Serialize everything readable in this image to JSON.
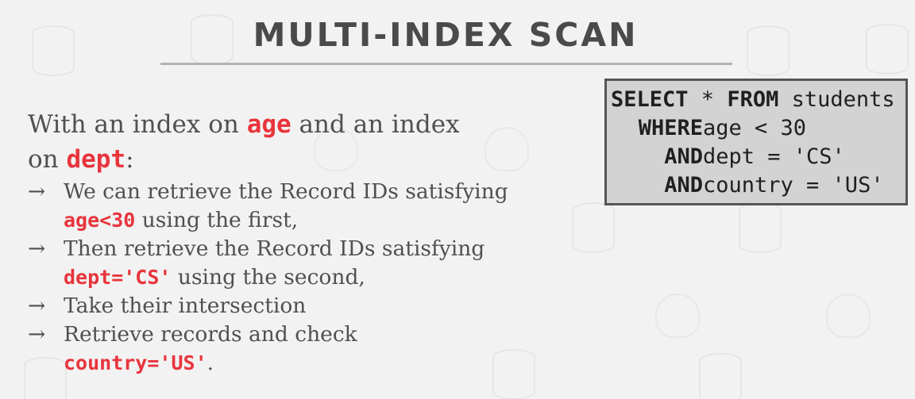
{
  "slide": {
    "title": "MULTI-INDEX SCAN"
  },
  "intro": {
    "text_1": "With an index on ",
    "code_1": "age",
    "text_2": " and an index",
    "text_3": "on ",
    "code_2": "dept",
    "text_4": ":"
  },
  "bullets": [
    {
      "arrow": "→",
      "line_1": "We can retrieve the Record IDs satisfying",
      "code": "age<30",
      "line_2": " using the first,"
    },
    {
      "arrow": "→",
      "line_1": "Then retrieve the Record IDs satisfying",
      "code": "dept='CS'",
      "line_2": " using the second,"
    },
    {
      "arrow": "→",
      "line_1": "Take their intersection"
    },
    {
      "arrow": "→",
      "line_1": "Retrieve records and check",
      "code": "country='US'",
      "line_2": "."
    }
  ],
  "sql": {
    "lines": [
      {
        "kw_1": "SELECT",
        "mid": " * ",
        "kw_2": "FROM",
        "rest": " students"
      },
      {
        "kw": "WHERE",
        "rest": "age < 30"
      },
      {
        "kw": "AND",
        "rest": "dept = 'CS'"
      },
      {
        "kw": "AND",
        "rest": "country = 'US'"
      }
    ]
  },
  "colors": {
    "background": "#f2f2f2",
    "code_highlight": "#e8343c",
    "sql_box_fill": "#d3d3d3",
    "sql_box_border": "#555555",
    "title_rule": "#b3b3b3"
  }
}
